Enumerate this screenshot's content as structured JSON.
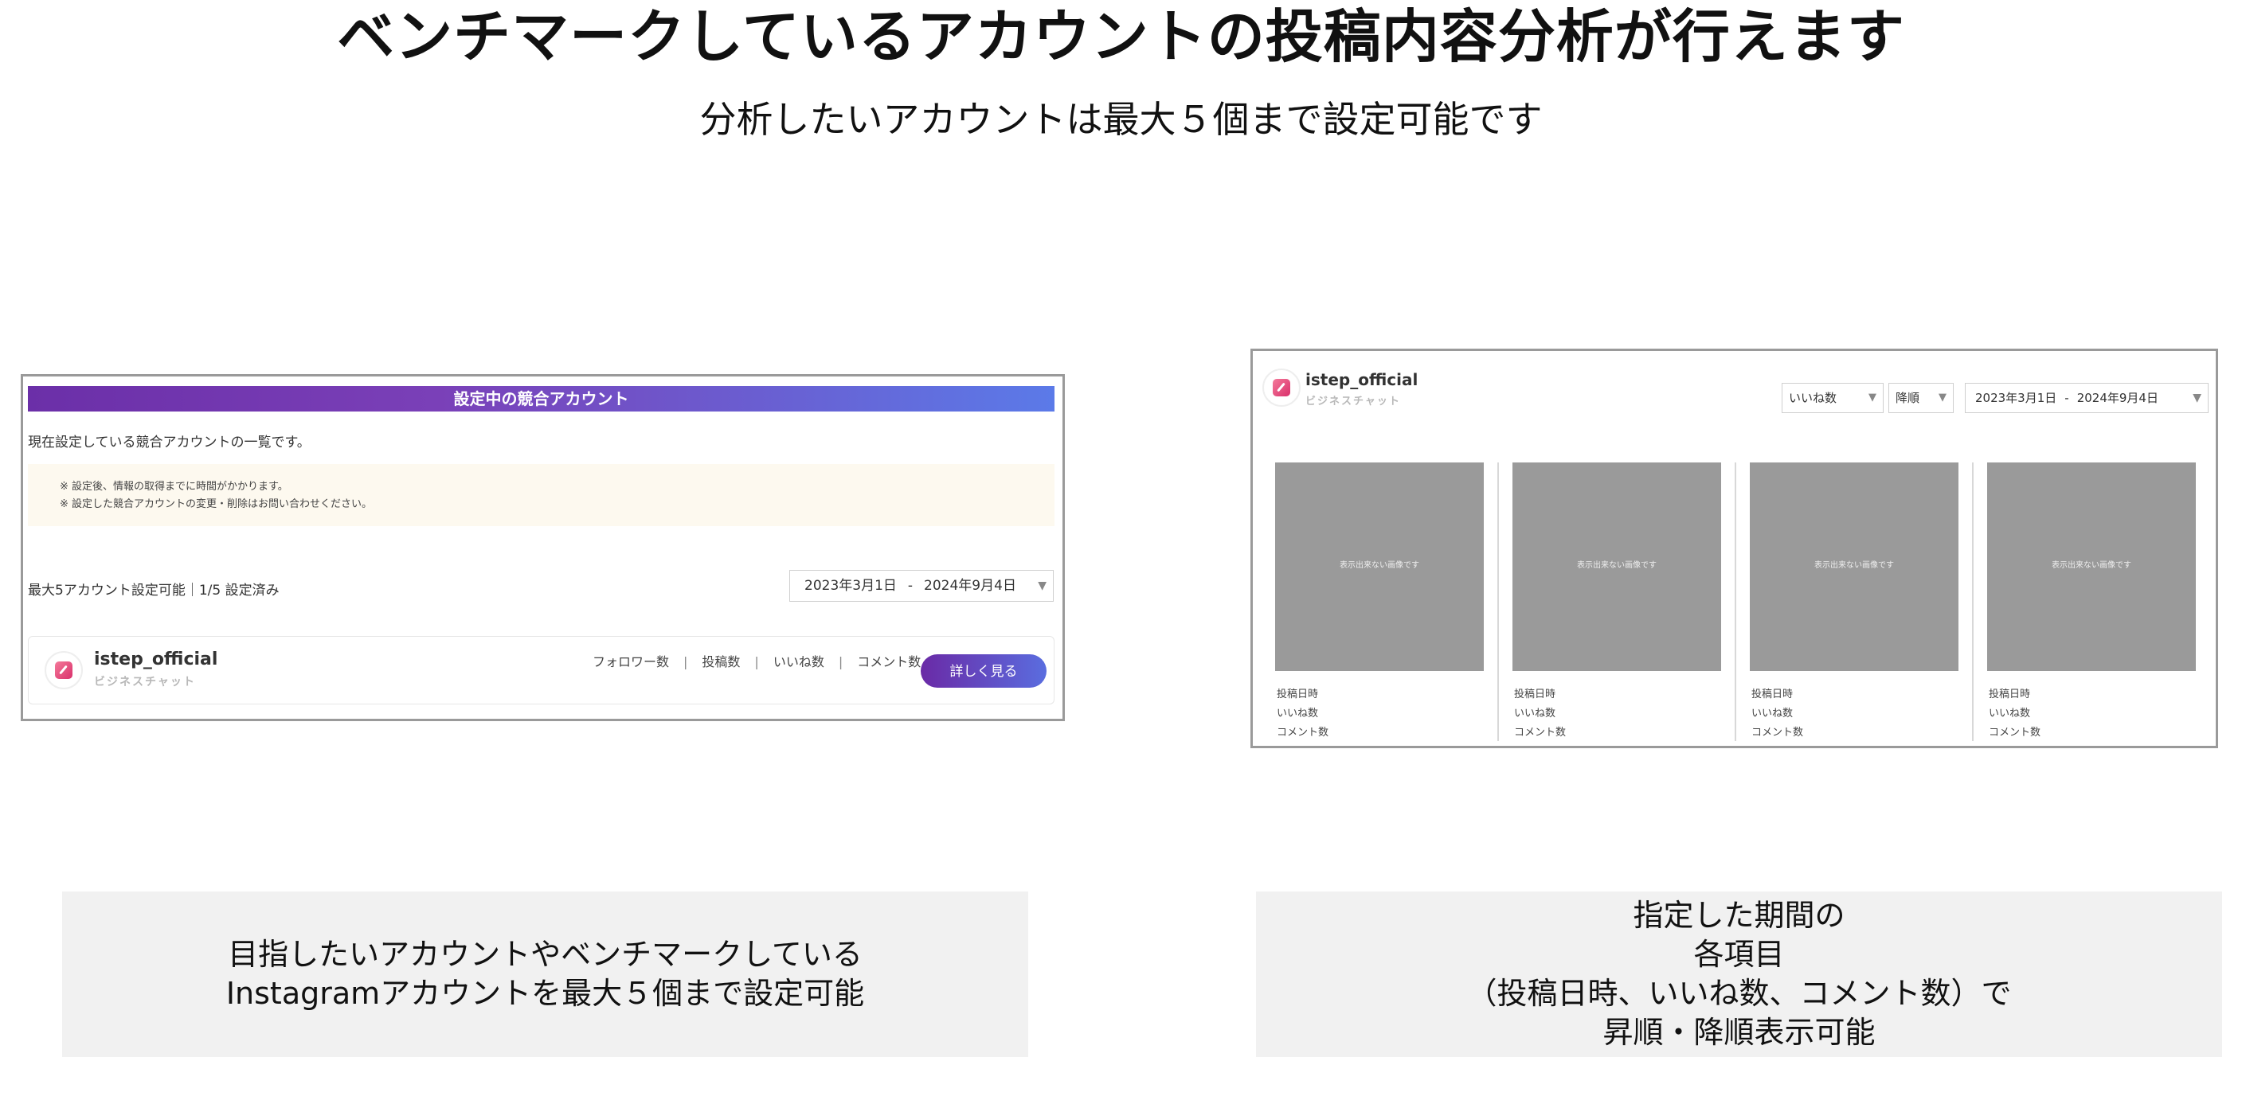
{
  "headline": {
    "title": "ベンチマークしているアカウントの投稿内容分析が行えます",
    "subtitle": "分析したいアカウントは最大５個まで設定可能です"
  },
  "left_panel": {
    "header": "設定中の競合アカウント",
    "description": "現在設定している競合アカウントの一覧です。",
    "notes": [
      "※ 設定後、情報の取得までに時間がかかります。",
      "※ 設定した競合アカウントの変更・削除はお問い合わせください。"
    ],
    "count_text": "最大5アカウント設定可能｜1/5 設定済み",
    "date_range": {
      "start": "2023年3月1日",
      "separator": "-",
      "end": "2024年9月4日"
    },
    "account": {
      "name": "istep_official",
      "sub": "ビジネスチャット"
    },
    "stats": [
      "フォロワー数",
      "投稿数",
      "いいね数",
      "コメント数"
    ],
    "stat_separator": "|",
    "detail_button": "詳しく見る"
  },
  "right_panel": {
    "account": {
      "name": "istep_official",
      "sub": "ビジネスチャット"
    },
    "sort_field": "いいね数",
    "sort_order": "降順",
    "date_range": {
      "start": "2023年3月1日",
      "separator": "-",
      "end": "2024年9月4日"
    },
    "posts": [
      {
        "placeholder": "表示出来ない画像です",
        "date_label": "投稿日時",
        "likes_label": "いいね数",
        "comments_label": "コメント数"
      },
      {
        "placeholder": "表示出来ない画像です",
        "date_label": "投稿日時",
        "likes_label": "いいね数",
        "comments_label": "コメント数"
      },
      {
        "placeholder": "表示出来ない画像です",
        "date_label": "投稿日時",
        "likes_label": "いいね数",
        "comments_label": "コメント数"
      },
      {
        "placeholder": "表示出来ない画像です",
        "date_label": "投稿日時",
        "likes_label": "いいね数",
        "comments_label": "コメント数"
      }
    ]
  },
  "captions": {
    "left": [
      "目指したいアカウントやベンチマークしている",
      "Instagramアカウントを最大５個まで設定可能"
    ],
    "right": [
      "指定した期間の",
      "各項目",
      "（投稿日時、いいね数、コメント数）で",
      "昇順・降順表示可能"
    ]
  },
  "caret_glyph": "▼",
  "colors": {
    "header_gradient_start": "#6b2fa8",
    "header_gradient_end": "#5b7ae8",
    "notes_bg": "#fdf9ef",
    "placeholder_gray": "#9a9a9a"
  }
}
